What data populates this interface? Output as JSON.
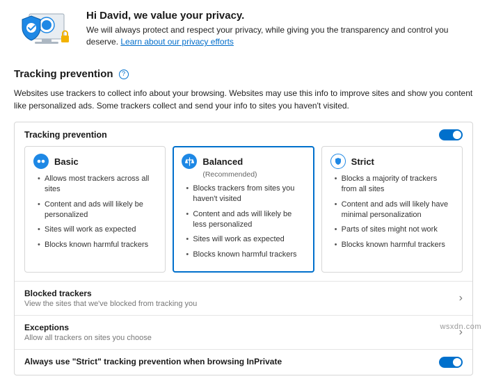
{
  "hero": {
    "title": "Hi David, we value your privacy.",
    "desc": "We will always protect and respect your privacy, while giving you the transparency and control you deserve. ",
    "link": "Learn about our privacy efforts"
  },
  "section": {
    "title": "Tracking prevention",
    "desc": "Websites use trackers to collect info about your browsing. Websites may use this info to improve sites and show you content like personalized ads. Some trackers collect and send your info to sites you haven't visited."
  },
  "panel": {
    "heading": "Tracking prevention",
    "toggle_on": true
  },
  "cards": {
    "basic": {
      "title": "Basic",
      "sub": "",
      "b0": "Allows most trackers across all sites",
      "b1": "Content and ads will likely be personalized",
      "b2": "Sites will work as expected",
      "b3": "Blocks known harmful trackers"
    },
    "balanced": {
      "title": "Balanced",
      "sub": "(Recommended)",
      "b0": "Blocks trackers from sites you haven't visited",
      "b1": "Content and ads will likely be less personalized",
      "b2": "Sites will work as expected",
      "b3": "Blocks known harmful trackers"
    },
    "strict": {
      "title": "Strict",
      "sub": "",
      "b0": "Blocks a majority of trackers from all sites",
      "b1": "Content and ads will likely have minimal personalization",
      "b2": "Parts of sites might not work",
      "b3": "Blocks known harmful trackers"
    }
  },
  "rows": {
    "blocked": {
      "title": "Blocked trackers",
      "sub": "View the sites that we've blocked from tracking you"
    },
    "exceptions": {
      "title": "Exceptions",
      "sub": "Allow all trackers on sites you choose"
    },
    "strictInprivate": {
      "title": "Always use \"Strict\" tracking prevention when browsing InPrivate"
    }
  },
  "watermark": "wsxdn.com"
}
